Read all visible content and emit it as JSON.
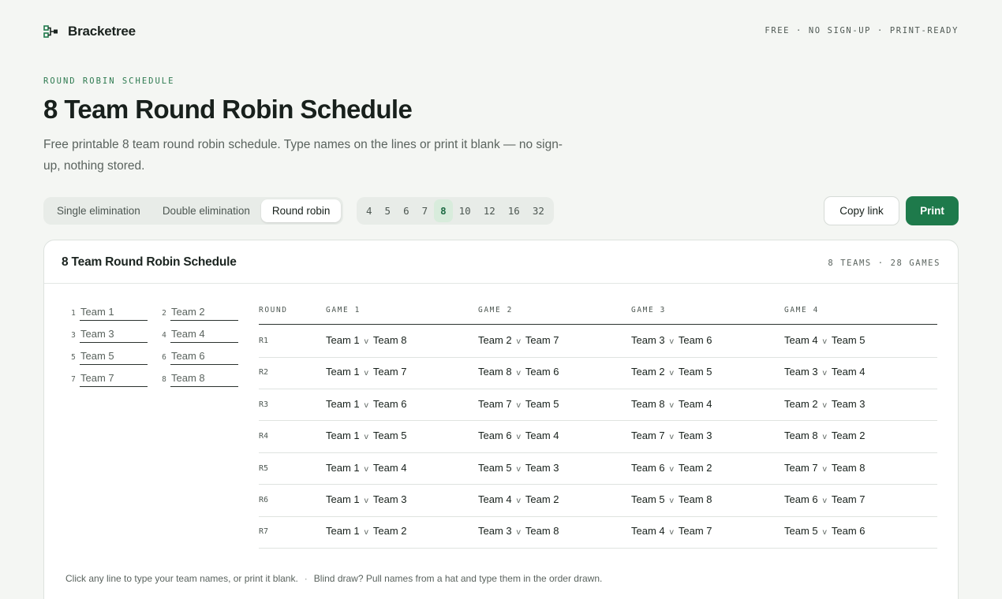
{
  "header": {
    "brand": "Bracketree",
    "tagline": "FREE · NO SIGN-UP · PRINT-READY"
  },
  "hero": {
    "eyebrow": "ROUND ROBIN SCHEDULE",
    "title": "8 Team Round Robin Schedule",
    "description": "Free printable 8 team round robin schedule. Type names on the lines or print it blank — no sign-up, nothing stored."
  },
  "formats": [
    {
      "label": "Single elimination",
      "active": false
    },
    {
      "label": "Double elimination",
      "active": false
    },
    {
      "label": "Round robin",
      "active": true
    }
  ],
  "team_counts": [
    {
      "label": "4",
      "active": false
    },
    {
      "label": "5",
      "active": false
    },
    {
      "label": "6",
      "active": false
    },
    {
      "label": "7",
      "active": false
    },
    {
      "label": "8",
      "active": true
    },
    {
      "label": "10",
      "active": false
    },
    {
      "label": "12",
      "active": false
    },
    {
      "label": "16",
      "active": false
    },
    {
      "label": "32",
      "active": false
    }
  ],
  "actions": {
    "copy_link": "Copy link",
    "print": "Print"
  },
  "card": {
    "title": "8 Team Round Robin Schedule",
    "meta": "8 TEAMS · 28 GAMES"
  },
  "teams": [
    {
      "num": "1",
      "name": "Team 1"
    },
    {
      "num": "2",
      "name": "Team 2"
    },
    {
      "num": "3",
      "name": "Team 3"
    },
    {
      "num": "4",
      "name": "Team 4"
    },
    {
      "num": "5",
      "name": "Team 5"
    },
    {
      "num": "6",
      "name": "Team 6"
    },
    {
      "num": "7",
      "name": "Team 7"
    },
    {
      "num": "8",
      "name": "Team 8"
    }
  ],
  "schedule": {
    "headers": [
      "ROUND",
      "GAME 1",
      "GAME 2",
      "GAME 3",
      "GAME 4"
    ],
    "vs": "v",
    "rounds": [
      {
        "label": "R1",
        "games": [
          [
            "Team 1",
            "Team 8"
          ],
          [
            "Team 2",
            "Team 7"
          ],
          [
            "Team 3",
            "Team 6"
          ],
          [
            "Team 4",
            "Team 5"
          ]
        ]
      },
      {
        "label": "R2",
        "games": [
          [
            "Team 1",
            "Team 7"
          ],
          [
            "Team 8",
            "Team 6"
          ],
          [
            "Team 2",
            "Team 5"
          ],
          [
            "Team 3",
            "Team 4"
          ]
        ]
      },
      {
        "label": "R3",
        "games": [
          [
            "Team 1",
            "Team 6"
          ],
          [
            "Team 7",
            "Team 5"
          ],
          [
            "Team 8",
            "Team 4"
          ],
          [
            "Team 2",
            "Team 3"
          ]
        ]
      },
      {
        "label": "R4",
        "games": [
          [
            "Team 1",
            "Team 5"
          ],
          [
            "Team 6",
            "Team 4"
          ],
          [
            "Team 7",
            "Team 3"
          ],
          [
            "Team 8",
            "Team 2"
          ]
        ]
      },
      {
        "label": "R5",
        "games": [
          [
            "Team 1",
            "Team 4"
          ],
          [
            "Team 5",
            "Team 3"
          ],
          [
            "Team 6",
            "Team 2"
          ],
          [
            "Team 7",
            "Team 8"
          ]
        ]
      },
      {
        "label": "R6",
        "games": [
          [
            "Team 1",
            "Team 3"
          ],
          [
            "Team 4",
            "Team 2"
          ],
          [
            "Team 5",
            "Team 8"
          ],
          [
            "Team 6",
            "Team 7"
          ]
        ]
      },
      {
        "label": "R7",
        "games": [
          [
            "Team 1",
            "Team 2"
          ],
          [
            "Team 3",
            "Team 8"
          ],
          [
            "Team 4",
            "Team 7"
          ],
          [
            "Team 5",
            "Team 6"
          ]
        ]
      }
    ]
  },
  "footnote": {
    "left": "Click any line to type your team names, or print it blank.",
    "separator": "·",
    "right": "Blind draw? Pull names from a hat and type them in the order drawn."
  },
  "colors": {
    "accent": "#1e7a4b",
    "accent_soft": "#d8ecdc",
    "background": "#f4f6f3"
  }
}
